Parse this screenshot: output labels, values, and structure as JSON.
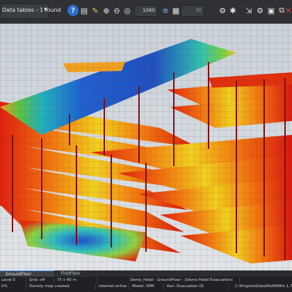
{
  "toolbar": {
    "view_select": "Data tables - 1 found",
    "zoom_value": "1060",
    "speed_value": "30",
    "icons": [
      "help-icon",
      "print-icon",
      "pencil-icon",
      "zoom-in-icon",
      "zoom-out-icon",
      "zoom-fit-icon",
      "layers-icon",
      "grid-icon",
      "settings-icon",
      "export-icon",
      "display-options-icon",
      "close-icon"
    ]
  },
  "tabs": {
    "active": "GroundFloor",
    "inactive": "FirstFloor"
  },
  "status": {
    "level": "Level 0",
    "grid": "Grid: off",
    "size": "75 x 40 m",
    "model_path": "Demo_Hotel - GroundFloor - (Demo Hotel Evacuation)",
    "progress": "0%",
    "progress_text": "Density map created",
    "connection": "Internet online",
    "model": "Model: SPM",
    "run": "Run: Evacuation 01",
    "file_path": "C:\\ProgramData\\PedHtMm 1.70\\"
  },
  "colors": {
    "toolbar_bg": "#2f3134",
    "density_low": "#2040c0",
    "density_high": "#e01010",
    "accent": "#5aa0ff"
  }
}
